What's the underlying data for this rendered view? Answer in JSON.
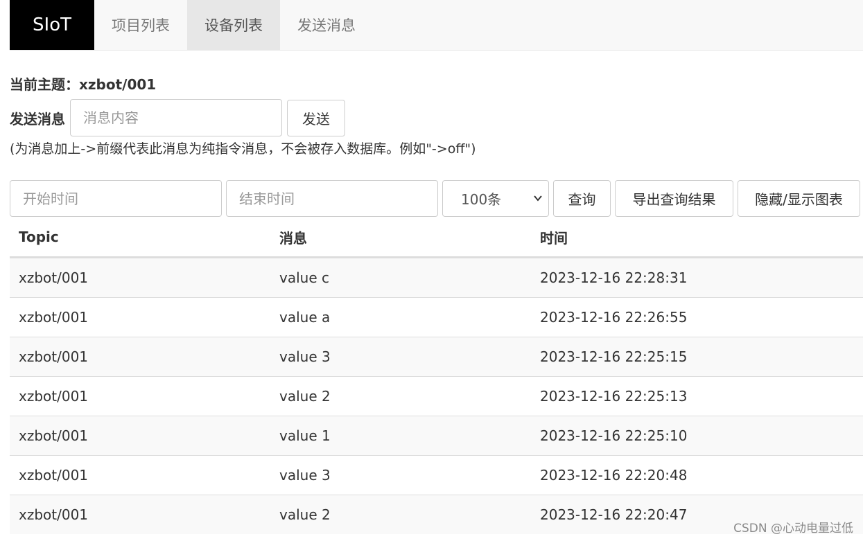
{
  "nav": {
    "brand": "SIoT",
    "items": [
      {
        "label": "项目列表",
        "active": false
      },
      {
        "label": "设备列表",
        "active": true
      },
      {
        "label": "发送消息",
        "active": false
      }
    ]
  },
  "topic": {
    "label": "当前主题：",
    "value": "xzbot/001"
  },
  "send": {
    "label": "发送消息",
    "input_placeholder": "消息内容",
    "input_value": "",
    "button_label": "发送"
  },
  "hint": "(为消息加上->前缀代表此消息为纯指令消息，不会被存入数据库。例如\"->off\")",
  "query": {
    "start_placeholder": "开始时间",
    "end_placeholder": "结束时间",
    "limit_selected": "100条",
    "query_button": "查询",
    "export_button": "导出查询结果",
    "toggle_chart_button": "隐藏/显示图表"
  },
  "table": {
    "headers": [
      "Topic",
      "消息",
      "时间"
    ],
    "rows": [
      [
        "xzbot/001",
        "value c",
        "2023-12-16 22:28:31"
      ],
      [
        "xzbot/001",
        "value a",
        "2023-12-16 22:26:55"
      ],
      [
        "xzbot/001",
        "value 3",
        "2023-12-16 22:25:15"
      ],
      [
        "xzbot/001",
        "value 2",
        "2023-12-16 22:25:13"
      ],
      [
        "xzbot/001",
        "value 1",
        "2023-12-16 22:25:10"
      ],
      [
        "xzbot/001",
        "value 3",
        "2023-12-16 22:20:48"
      ],
      [
        "xzbot/001",
        "value 2",
        "2023-12-16 22:20:47"
      ]
    ]
  },
  "watermark": "CSDN @心动电量过低"
}
